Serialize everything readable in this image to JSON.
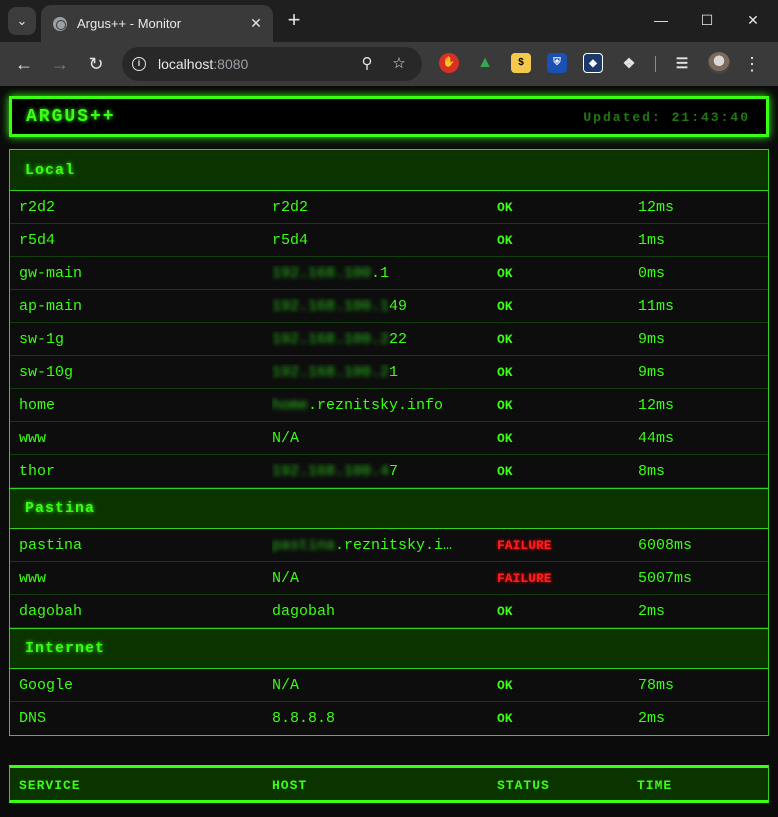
{
  "browser": {
    "tab_title": "Argus++ - Monitor",
    "url_host": "localhost",
    "url_port": ":8080",
    "icons": [
      "back-arrow-icon",
      "forward-arrow-icon",
      "reload-icon",
      "site-info-icon",
      "zoom-icon",
      "bookmark-star-icon",
      "extensions-puzzle-icon",
      "reading-list-icon",
      "menu-kebab-icon"
    ]
  },
  "app": {
    "title": "ARGUS++",
    "updated": "Updated: 21:43:40"
  },
  "groups": [
    {
      "name": "Local",
      "rows": [
        {
          "service": "r2d2",
          "host_blur": "",
          "host": "r2d2",
          "status": "OK",
          "time": "12ms"
        },
        {
          "service": "r5d4",
          "host_blur": "",
          "host": "r5d4",
          "status": "OK",
          "time": "1ms"
        },
        {
          "service": "gw-main",
          "host_blur": "192.168.100",
          "host": ".1",
          "status": "OK",
          "time": "0ms"
        },
        {
          "service": "ap-main",
          "host_blur": "192.168.100.1",
          "host": "49",
          "status": "OK",
          "time": "11ms"
        },
        {
          "service": "sw-1g",
          "host_blur": "192.168.100.2",
          "host": "22",
          "status": "OK",
          "time": "9ms"
        },
        {
          "service": "sw-10g",
          "host_blur": "192.168.100.2",
          "host": "1",
          "status": "OK",
          "time": "9ms"
        },
        {
          "service": "home",
          "host_blur": "home",
          "host": ".reznitsky.info",
          "status": "OK",
          "time": "12ms"
        },
        {
          "service": "www",
          "host_blur": "",
          "host": "N/A",
          "status": "OK",
          "time": "44ms"
        },
        {
          "service": "thor",
          "host_blur": "192.168.100.4",
          "host": "7",
          "status": "OK",
          "time": "8ms"
        }
      ]
    },
    {
      "name": "Pastina",
      "rows": [
        {
          "service": "pastina",
          "host_blur": "pastina",
          "host": ".reznitsky.i…",
          "status": "FAILURE",
          "time": "6008ms"
        },
        {
          "service": "www",
          "host_blur": "",
          "host": "N/A",
          "status": "FAILURE",
          "time": "5007ms"
        },
        {
          "service": "dagobah",
          "host_blur": "",
          "host": "dagobah",
          "status": "OK",
          "time": "2ms"
        }
      ]
    },
    {
      "name": "Internet",
      "rows": [
        {
          "service": "Google",
          "host_blur": "",
          "host": "N/A",
          "status": "OK",
          "time": "78ms"
        },
        {
          "service": "DNS",
          "host_blur": "",
          "host": "8.8.8.8",
          "status": "OK",
          "time": "2ms"
        }
      ]
    }
  ],
  "columns": {
    "service": "SERVICE",
    "host": "HOST",
    "status": "STATUS",
    "time": "TIME"
  },
  "colors": {
    "accent": "#39ff14",
    "failure": "#ff1f1f",
    "group_bg": "#0a3300"
  }
}
